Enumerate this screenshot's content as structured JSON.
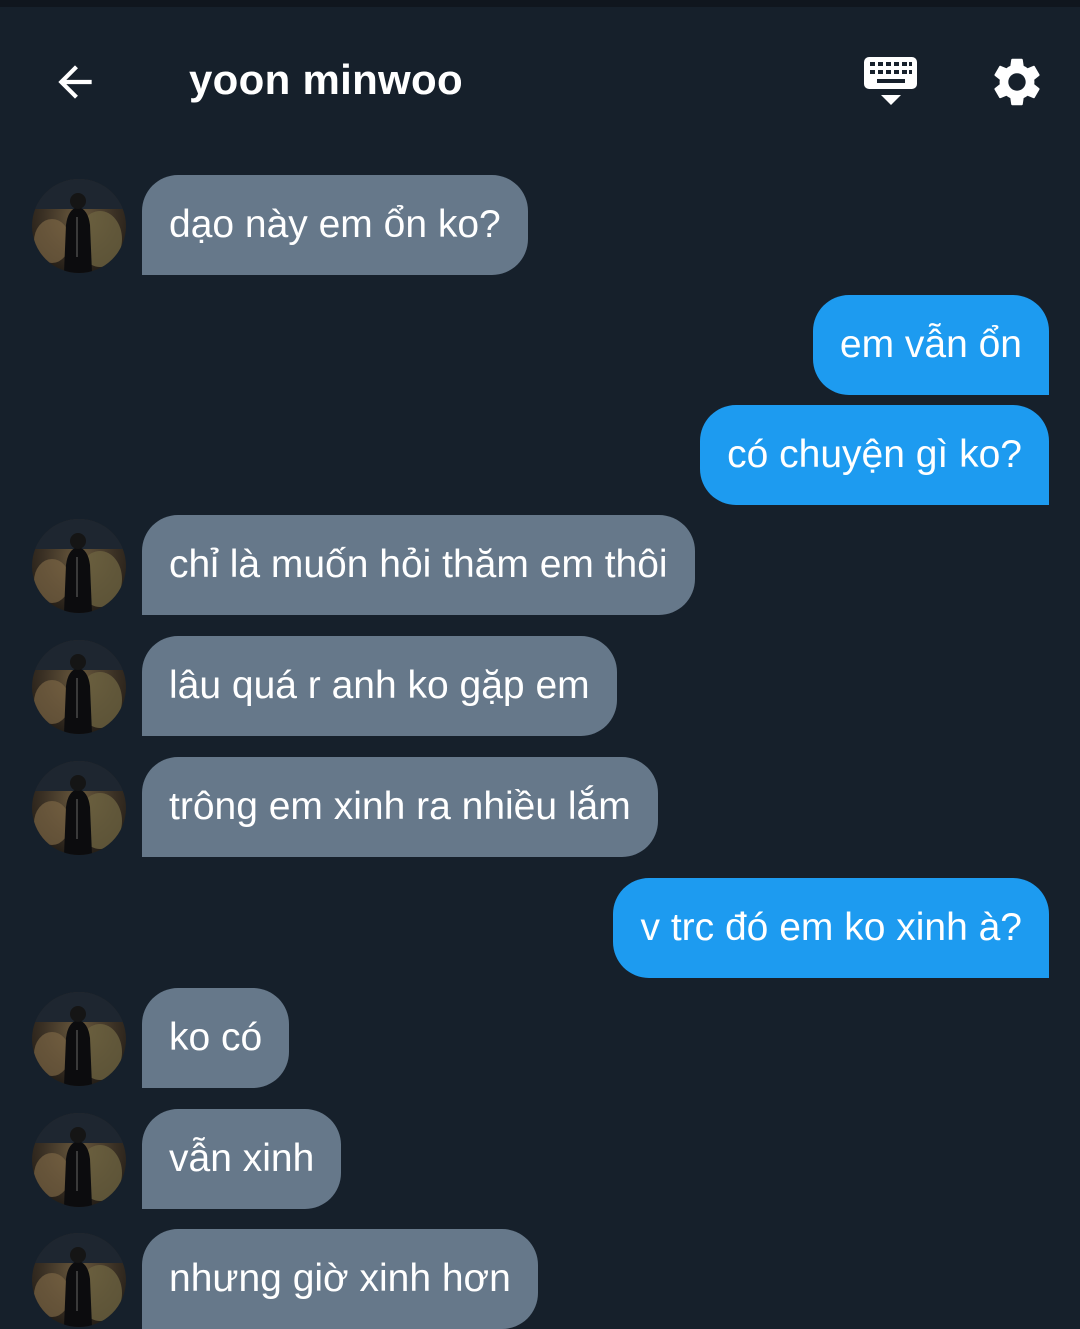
{
  "header": {
    "title": "yoon minwoo",
    "back_icon": "arrow-left-icon",
    "keyboard_icon": "keyboard-icon",
    "settings_icon": "gear-icon"
  },
  "colors": {
    "background": "#16202b",
    "incoming_bubble": "#66788a",
    "outgoing_bubble": "#1d9bf0",
    "text": "#ffffff"
  },
  "messages": [
    {
      "sender": "them",
      "text": "dạo này em ổn ko?"
    },
    {
      "sender": "me",
      "text": "em vẫn ổn"
    },
    {
      "sender": "me",
      "text": "có chuyện gì ko?"
    },
    {
      "sender": "them",
      "text": "chỉ là muốn hỏi thăm em thôi"
    },
    {
      "sender": "them",
      "text": "lâu quá r anh ko gặp em"
    },
    {
      "sender": "them",
      "text": "trông em xinh ra nhiều lắm"
    },
    {
      "sender": "me",
      "text": "v trc đó em ko xinh à?"
    },
    {
      "sender": "them",
      "text": "ko có"
    },
    {
      "sender": "them",
      "text": "vẫn xinh"
    },
    {
      "sender": "them",
      "text": "nhưng giờ xinh hơn"
    }
  ]
}
